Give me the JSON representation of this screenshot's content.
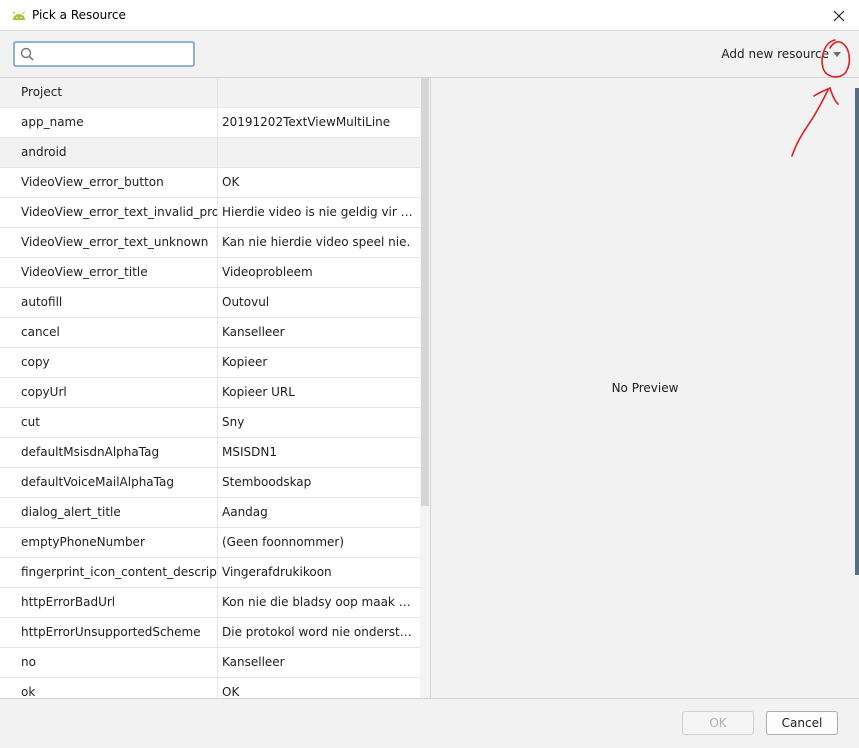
{
  "window": {
    "title": "Pick a Resource"
  },
  "toolbar": {
    "search_value": "",
    "add_new_label": "Add new resource"
  },
  "table": {
    "rows": [
      {
        "name": "Project",
        "value": "",
        "group": true
      },
      {
        "name": "app_name",
        "value": "20191202TextViewMultiLine"
      },
      {
        "name": "android",
        "value": "",
        "group": true
      },
      {
        "name": "VideoView_error_button",
        "value": "OK"
      },
      {
        "name": "VideoView_error_text_invalid_progres",
        "value": "Hierdie video is nie geldig vir strom..."
      },
      {
        "name": "VideoView_error_text_unknown",
        "value": "Kan nie hierdie video speel nie."
      },
      {
        "name": "VideoView_error_title",
        "value": "Videoprobleem"
      },
      {
        "name": "autofill",
        "value": "Outovul"
      },
      {
        "name": "cancel",
        "value": "Kanselleer"
      },
      {
        "name": "copy",
        "value": "Kopieer"
      },
      {
        "name": "copyUrl",
        "value": "Kopieer URL"
      },
      {
        "name": "cut",
        "value": "Sny"
      },
      {
        "name": "defaultMsisdnAlphaTag",
        "value": "MSISDN1"
      },
      {
        "name": "defaultVoiceMailAlphaTag",
        "value": "Stemboodskap"
      },
      {
        "name": "dialog_alert_title",
        "value": "Aandag"
      },
      {
        "name": "emptyPhoneNumber",
        "value": "(Geen foonnommer)"
      },
      {
        "name": "fingerprint_icon_content_description",
        "value": "Vingerafdrukikoon"
      },
      {
        "name": "httpErrorBadUrl",
        "value": "Kon nie die bladsy oop maak nie, w..."
      },
      {
        "name": "httpErrorUnsupportedScheme",
        "value": "Die protokol word nie ondersteun ..."
      },
      {
        "name": "no",
        "value": "Kanselleer"
      },
      {
        "name": "ok",
        "value": "OK"
      }
    ]
  },
  "preview": {
    "message": "No Preview"
  },
  "footer": {
    "ok_label": "OK",
    "cancel_label": "Cancel"
  },
  "colors": {
    "accent": "#8fb0d8",
    "annotation": "#e02020",
    "android_green": "#a4c639"
  }
}
